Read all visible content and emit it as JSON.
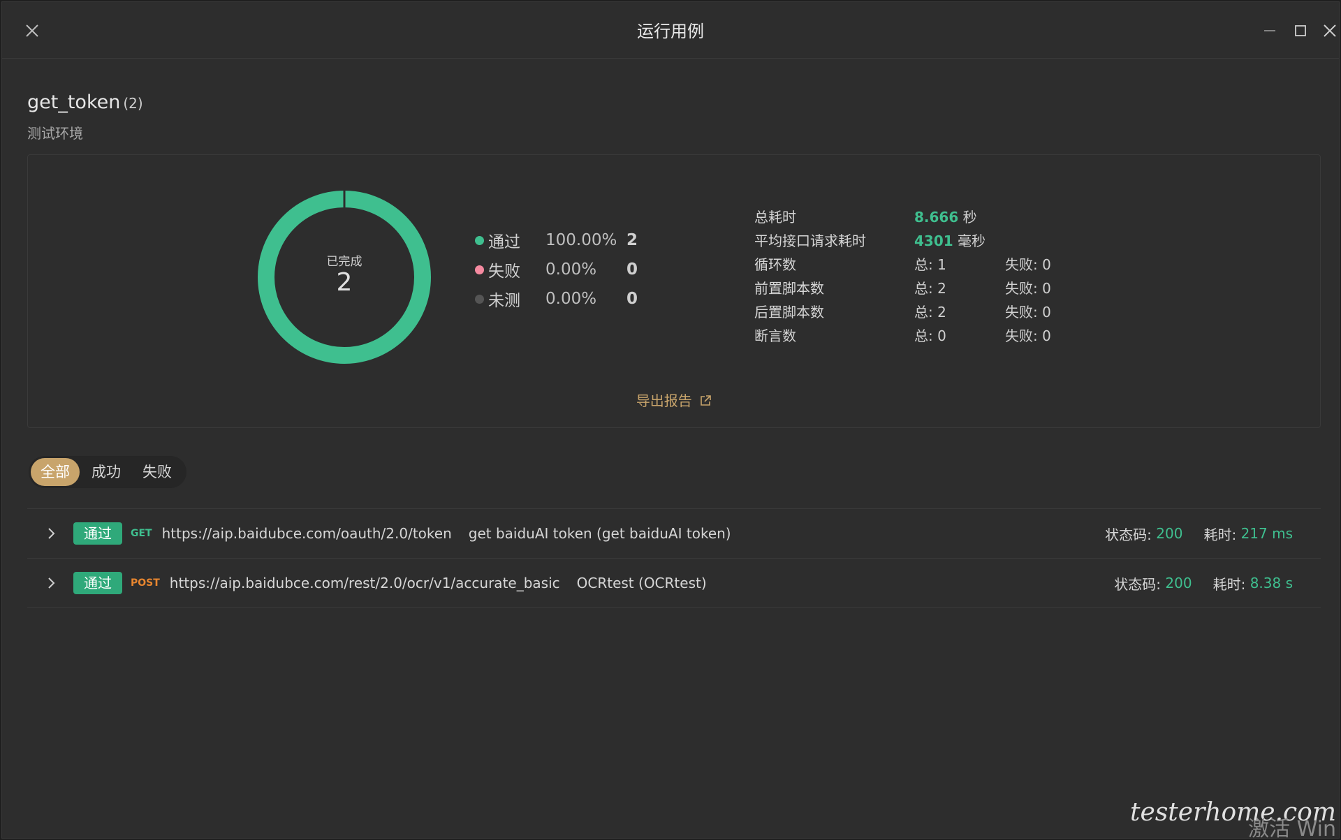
{
  "window": {
    "title": "运行用例",
    "close_left_icon": "close-icon",
    "minimize_icon": "minimize-icon",
    "maximize_icon": "maximize-icon",
    "close_icon": "close-icon"
  },
  "header": {
    "name": "get_token",
    "count": "(2)",
    "environment": "测试环境"
  },
  "summary": {
    "donut_label": "已完成",
    "donut_value": "2",
    "legend": [
      {
        "name": "通过",
        "percent": "100.00%",
        "count": "2",
        "color": "#3fbf8f"
      },
      {
        "name": "失败",
        "percent": "0.00%",
        "count": "0",
        "color": "#f58aa0"
      },
      {
        "name": "未测",
        "percent": "0.00%",
        "count": "0",
        "color": "#555555"
      }
    ],
    "stats": [
      {
        "label": "总耗时",
        "value": "8.666",
        "unit": "秒"
      },
      {
        "label": "平均接口请求耗时",
        "value": "4301",
        "unit": "毫秒"
      },
      {
        "label": "循环数",
        "total": "总: 1",
        "failed": "失败: 0"
      },
      {
        "label": "前置脚本数",
        "total": "总: 2",
        "failed": "失败: 0"
      },
      {
        "label": "后置脚本数",
        "total": "总: 2",
        "failed": "失败: 0"
      },
      {
        "label": "断言数",
        "total": "总: 0",
        "failed": "失败: 0"
      }
    ],
    "export_label": "导出报告"
  },
  "chart_data": {
    "type": "pie",
    "categories": [
      "通过",
      "失败",
      "未测"
    ],
    "values": [
      2,
      0,
      0
    ]
  },
  "filters": [
    {
      "label": "全部",
      "active": true
    },
    {
      "label": "成功",
      "active": false
    },
    {
      "label": "失败",
      "active": false
    }
  ],
  "results": [
    {
      "status": "通过",
      "method": "GET",
      "method_color": "#3fbf8f",
      "url": "https://aip.baidubce.com/oauth/2.0/token",
      "name": "get baiduAI token (get baiduAI token)",
      "status_code_label": "状态码:",
      "status_code": "200",
      "time_label": "耗时:",
      "time": "217 ms"
    },
    {
      "status": "通过",
      "method": "POST",
      "method_color": "#e8862f",
      "url": "https://aip.baidubce.com/rest/2.0/ocr/v1/accurate_basic",
      "name": "OCRtest (OCRtest)",
      "status_code_label": "状态码:",
      "status_code": "200",
      "time_label": "耗时:",
      "time": "8.38 s"
    }
  ],
  "watermark": "testerhome.com",
  "activate_text": "激活 Win"
}
